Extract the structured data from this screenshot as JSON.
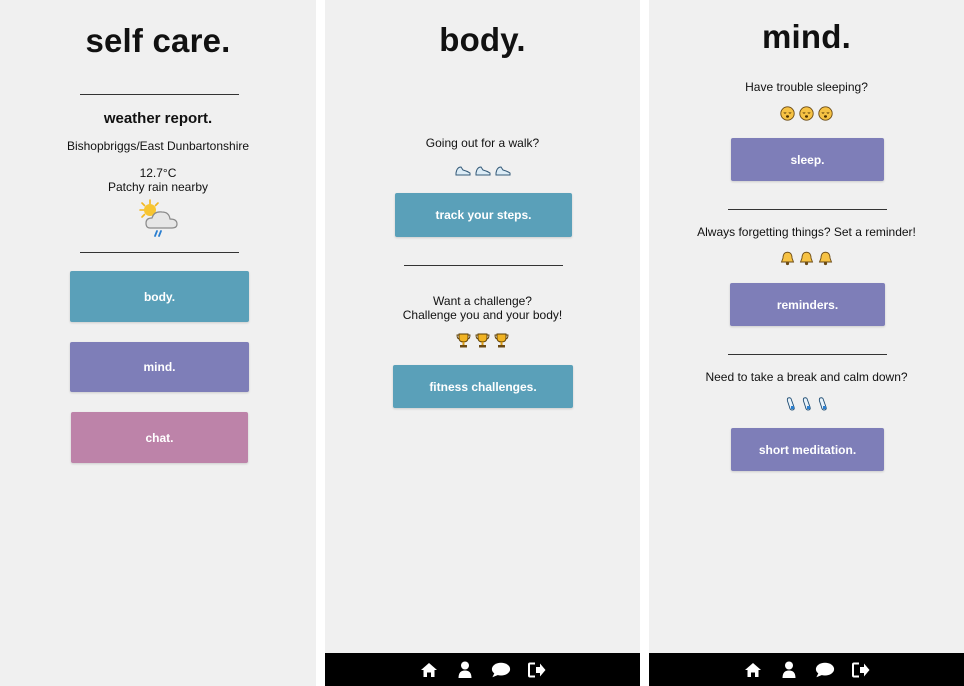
{
  "colors": {
    "teal": "#5aa0b9",
    "purple": "#7e7eb8",
    "pink": "#bd83a9",
    "background": "#f0f0f0",
    "footer": "#000000"
  },
  "home": {
    "title": "self care.",
    "weather": {
      "heading": "weather report.",
      "location": "Bishopbriggs/East Dunbartonshire",
      "temperature": "12.7°C",
      "condition": "Patchy rain nearby",
      "icon": "sun-cloud-rain-icon"
    },
    "buttons": {
      "body": "body.",
      "mind": "mind.",
      "chat": "chat."
    }
  },
  "body_page": {
    "title": "body.",
    "walk_prompt": "Going out for a walk?",
    "walk_icon": "shoe-icon",
    "steps_button": "track your steps.",
    "challenge_prompt_1": "Want a challenge?",
    "challenge_prompt_2": "Challenge you and your body!",
    "challenge_icon": "trophy-icon",
    "challenges_button": "fitness challenges."
  },
  "mind_page": {
    "title": "mind.",
    "sleep_prompt": "Have trouble sleeping?",
    "sleep_icon": "sleeping-face-icon",
    "sleep_button": "sleep.",
    "reminder_prompt": "Always forgetting things? Set a reminder!",
    "reminder_icon": "bell-icon",
    "reminders_button": "reminders.",
    "break_prompt": "Need to take a break and calm down?",
    "break_icon": "feet-icon",
    "meditation_button": "short meditation."
  },
  "footer_icons": [
    "home-icon",
    "user-icon",
    "chat-icon",
    "logout-icon"
  ]
}
